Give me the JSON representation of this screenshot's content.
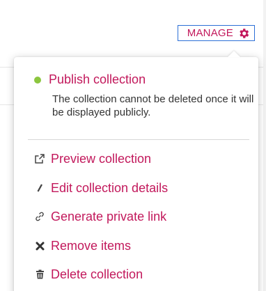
{
  "toolbar": {
    "manage_label": "MANAGE",
    "manage_icon": "gear-icon"
  },
  "menu": {
    "publish": {
      "label": "Publish collection",
      "status_icon": "status-dot-icon",
      "note": "The collection cannot be deleted once it will be displayed publicly."
    },
    "items": [
      {
        "label": "Preview collection",
        "icon": "external-link-icon"
      },
      {
        "label": "Edit collection details",
        "icon": "pencil-icon"
      },
      {
        "label": "Generate private link",
        "icon": "link-icon"
      },
      {
        "label": "Remove items",
        "icon": "close-icon"
      },
      {
        "label": "Delete collection",
        "icon": "trash-icon"
      }
    ]
  },
  "colors": {
    "accent": "#c2185b",
    "status_green": "#8cc63f",
    "focus_border": "#2c6fd6",
    "text": "#333333"
  }
}
